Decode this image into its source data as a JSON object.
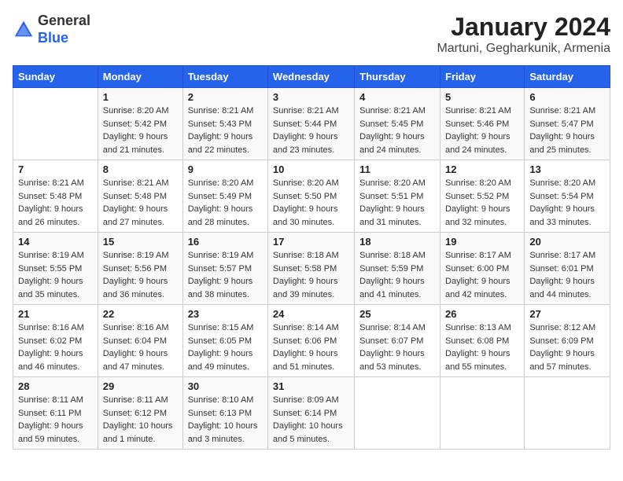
{
  "header": {
    "logo_line1": "General",
    "logo_line2": "Blue",
    "month_title": "January 2024",
    "location": "Martuni, Gegharkunik, Armenia"
  },
  "days_of_week": [
    "Sunday",
    "Monday",
    "Tuesday",
    "Wednesday",
    "Thursday",
    "Friday",
    "Saturday"
  ],
  "weeks": [
    [
      {
        "day": "",
        "sunrise": "",
        "sunset": "",
        "daylight": ""
      },
      {
        "day": "1",
        "sunrise": "8:20 AM",
        "sunset": "5:42 PM",
        "daylight": "9 hours and 21 minutes."
      },
      {
        "day": "2",
        "sunrise": "8:21 AM",
        "sunset": "5:43 PM",
        "daylight": "9 hours and 22 minutes."
      },
      {
        "day": "3",
        "sunrise": "8:21 AM",
        "sunset": "5:44 PM",
        "daylight": "9 hours and 23 minutes."
      },
      {
        "day": "4",
        "sunrise": "8:21 AM",
        "sunset": "5:45 PM",
        "daylight": "9 hours and 24 minutes."
      },
      {
        "day": "5",
        "sunrise": "8:21 AM",
        "sunset": "5:46 PM",
        "daylight": "9 hours and 24 minutes."
      },
      {
        "day": "6",
        "sunrise": "8:21 AM",
        "sunset": "5:47 PM",
        "daylight": "9 hours and 25 minutes."
      }
    ],
    [
      {
        "day": "7",
        "sunrise": "8:21 AM",
        "sunset": "5:48 PM",
        "daylight": "9 hours and 26 minutes."
      },
      {
        "day": "8",
        "sunrise": "8:21 AM",
        "sunset": "5:48 PM",
        "daylight": "9 hours and 27 minutes."
      },
      {
        "day": "9",
        "sunrise": "8:20 AM",
        "sunset": "5:49 PM",
        "daylight": "9 hours and 28 minutes."
      },
      {
        "day": "10",
        "sunrise": "8:20 AM",
        "sunset": "5:50 PM",
        "daylight": "9 hours and 30 minutes."
      },
      {
        "day": "11",
        "sunrise": "8:20 AM",
        "sunset": "5:51 PM",
        "daylight": "9 hours and 31 minutes."
      },
      {
        "day": "12",
        "sunrise": "8:20 AM",
        "sunset": "5:52 PM",
        "daylight": "9 hours and 32 minutes."
      },
      {
        "day": "13",
        "sunrise": "8:20 AM",
        "sunset": "5:54 PM",
        "daylight": "9 hours and 33 minutes."
      }
    ],
    [
      {
        "day": "14",
        "sunrise": "8:19 AM",
        "sunset": "5:55 PM",
        "daylight": "9 hours and 35 minutes."
      },
      {
        "day": "15",
        "sunrise": "8:19 AM",
        "sunset": "5:56 PM",
        "daylight": "9 hours and 36 minutes."
      },
      {
        "day": "16",
        "sunrise": "8:19 AM",
        "sunset": "5:57 PM",
        "daylight": "9 hours and 38 minutes."
      },
      {
        "day": "17",
        "sunrise": "8:18 AM",
        "sunset": "5:58 PM",
        "daylight": "9 hours and 39 minutes."
      },
      {
        "day": "18",
        "sunrise": "8:18 AM",
        "sunset": "5:59 PM",
        "daylight": "9 hours and 41 minutes."
      },
      {
        "day": "19",
        "sunrise": "8:17 AM",
        "sunset": "6:00 PM",
        "daylight": "9 hours and 42 minutes."
      },
      {
        "day": "20",
        "sunrise": "8:17 AM",
        "sunset": "6:01 PM",
        "daylight": "9 hours and 44 minutes."
      }
    ],
    [
      {
        "day": "21",
        "sunrise": "8:16 AM",
        "sunset": "6:02 PM",
        "daylight": "9 hours and 46 minutes."
      },
      {
        "day": "22",
        "sunrise": "8:16 AM",
        "sunset": "6:04 PM",
        "daylight": "9 hours and 47 minutes."
      },
      {
        "day": "23",
        "sunrise": "8:15 AM",
        "sunset": "6:05 PM",
        "daylight": "9 hours and 49 minutes."
      },
      {
        "day": "24",
        "sunrise": "8:14 AM",
        "sunset": "6:06 PM",
        "daylight": "9 hours and 51 minutes."
      },
      {
        "day": "25",
        "sunrise": "8:14 AM",
        "sunset": "6:07 PM",
        "daylight": "9 hours and 53 minutes."
      },
      {
        "day": "26",
        "sunrise": "8:13 AM",
        "sunset": "6:08 PM",
        "daylight": "9 hours and 55 minutes."
      },
      {
        "day": "27",
        "sunrise": "8:12 AM",
        "sunset": "6:09 PM",
        "daylight": "9 hours and 57 minutes."
      }
    ],
    [
      {
        "day": "28",
        "sunrise": "8:11 AM",
        "sunset": "6:11 PM",
        "daylight": "9 hours and 59 minutes."
      },
      {
        "day": "29",
        "sunrise": "8:11 AM",
        "sunset": "6:12 PM",
        "daylight": "10 hours and 1 minute."
      },
      {
        "day": "30",
        "sunrise": "8:10 AM",
        "sunset": "6:13 PM",
        "daylight": "10 hours and 3 minutes."
      },
      {
        "day": "31",
        "sunrise": "8:09 AM",
        "sunset": "6:14 PM",
        "daylight": "10 hours and 5 minutes."
      },
      {
        "day": "",
        "sunrise": "",
        "sunset": "",
        "daylight": ""
      },
      {
        "day": "",
        "sunrise": "",
        "sunset": "",
        "daylight": ""
      },
      {
        "day": "",
        "sunrise": "",
        "sunset": "",
        "daylight": ""
      }
    ]
  ],
  "labels": {
    "sunrise": "Sunrise:",
    "sunset": "Sunset:",
    "daylight": "Daylight:"
  }
}
